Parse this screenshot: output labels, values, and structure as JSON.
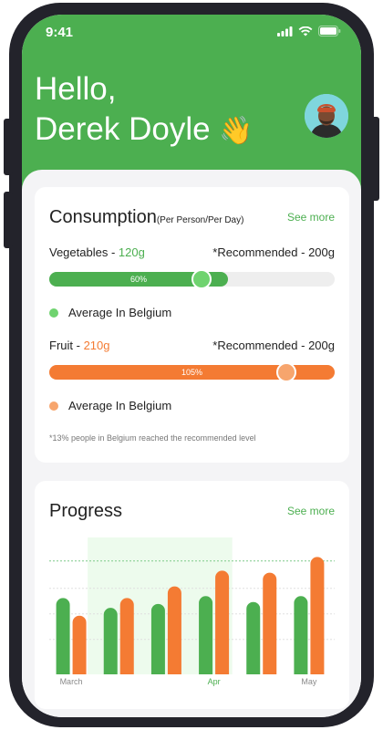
{
  "status_bar": {
    "time": "9:41"
  },
  "header": {
    "greeting_line1": "Hello,",
    "greeting_line2": "Derek Doyle",
    "wave_emoji": "👋"
  },
  "colors": {
    "green": "#4caf50",
    "light_green": "#6fd36f",
    "orange": "#f47b33",
    "light_orange": "#f7a56d"
  },
  "consumption": {
    "title": "Consumption",
    "subtitle": "(Per Person/Per Day)",
    "see_more": "See more",
    "vegetables": {
      "label": "Vegetables - ",
      "amount": "120g",
      "recommended": "*Recommended - 200g",
      "percent_text": "60%",
      "percent": 60,
      "average_label": "Average In Belgium"
    },
    "fruit": {
      "label": "Fruit - ",
      "amount": "210g",
      "recommended": "*Recommended - 200g",
      "percent_text": "105%",
      "percent": 105,
      "average_label": "Average In Belgium"
    },
    "footnote": "*13% people in Belgium reached the recommended  level"
  },
  "progress": {
    "title": "Progress",
    "see_more": "See more",
    "chart_data": {
      "type": "bar",
      "categories": [
        "March",
        "",
        "",
        "Apr",
        "",
        "May"
      ],
      "series": [
        {
          "values": [
            78,
            68,
            72,
            80,
            74,
            80
          ]
        },
        {
          "values": [
            60,
            78,
            90,
            106,
            104,
            120
          ]
        }
      ],
      "recommended_line": 116,
      "ylim": [
        0,
        140
      ],
      "highlighted_range": [
        "",
        "Apr"
      ],
      "x_tick_labels": [
        "March",
        "Apr",
        "May"
      ],
      "active_tick": "Apr"
    }
  }
}
